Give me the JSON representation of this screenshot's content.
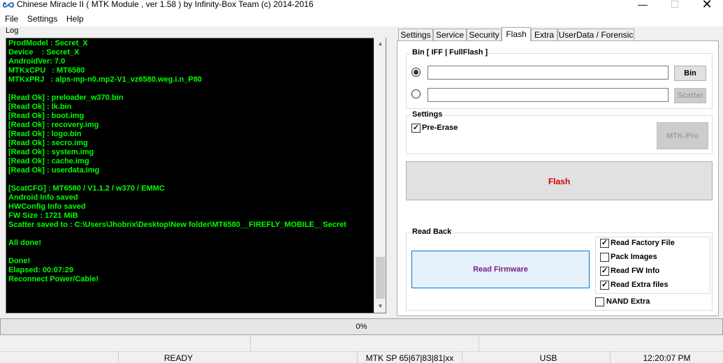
{
  "window": {
    "title": "Chinese Miracle II ( MTK Module , ver 1.58 ) by Infinity-Box Team (c) 2014-2016",
    "min_glyph": "—",
    "max_glyph": "☐",
    "close_glyph": "✕"
  },
  "menu": [
    "File",
    "Settings",
    "Help"
  ],
  "log": {
    "label": "Log",
    "lines": [
      "ProdModel : Secret_X",
      "Device    : Secret_X",
      "AndroidVer: 7.0",
      "MTKxCPU   : MT6580",
      "MTKxPRJ   : alps-mp-n0.mp2-V1_vz6580.weg.i.n_P80",
      "",
      "[Read Ok] : preloader_w370.bin",
      "[Read Ok] : lk.bin",
      "[Read Ok] : boot.img",
      "[Read Ok] : recovery.img",
      "[Read Ok] : logo.bin",
      "[Read Ok] : secro.img",
      "[Read Ok] : system.img",
      "[Read Ok] : cache.img",
      "[Read Ok] : userdata.img",
      "",
      "[ScatCFG] : MT6580 / V1.1.2 / w370 / EMMC",
      "Android Info saved",
      "HWConfig Info saved",
      "FW Size : 1721 MiB",
      "Scatter saved to : C:\\Users\\Jhobrix\\Desktop\\New folder\\MT6580__FIREFLY_MOBILE__Secret",
      "",
      "All done!",
      "",
      "Done!",
      "Elapsed: 00:07:29",
      "Reconnect Power/Cable!"
    ]
  },
  "tabs": [
    {
      "label": "Settings",
      "active": false
    },
    {
      "label": "Service",
      "active": false
    },
    {
      "label": "Security",
      "active": false
    },
    {
      "label": "Flash",
      "active": true
    },
    {
      "label": "Extra",
      "active": false
    },
    {
      "label": "UserData / Forensic",
      "active": false
    }
  ],
  "flash": {
    "bin_group_title": "Bin  [ IFF | FullFlash ]",
    "bin_path": "",
    "scatter_path": "",
    "bin_button": "Bin",
    "scatter_button": "Scatter",
    "settings_title": "Settings",
    "pre_erase_label": "Pre-Erase",
    "mtk_pro_button": "MTK-Pro",
    "flash_button": "Flash",
    "readback_title": "Read Back",
    "read_firmware_button": "Read Firmware",
    "options": {
      "read_factory_file": "Read Factory File",
      "pack_images": "Pack Images",
      "read_fw_info": "Read FW Info",
      "read_extra_files": "Read Extra files",
      "nand_extra": "NAND Extra"
    },
    "check_glyph": "✓"
  },
  "progress": {
    "text": "0%",
    "value": 0
  },
  "status": {
    "state": "READY",
    "device": "MTK SP 65|67|83|81|xx",
    "connection": "USB",
    "time": "12:20:07 PM"
  }
}
